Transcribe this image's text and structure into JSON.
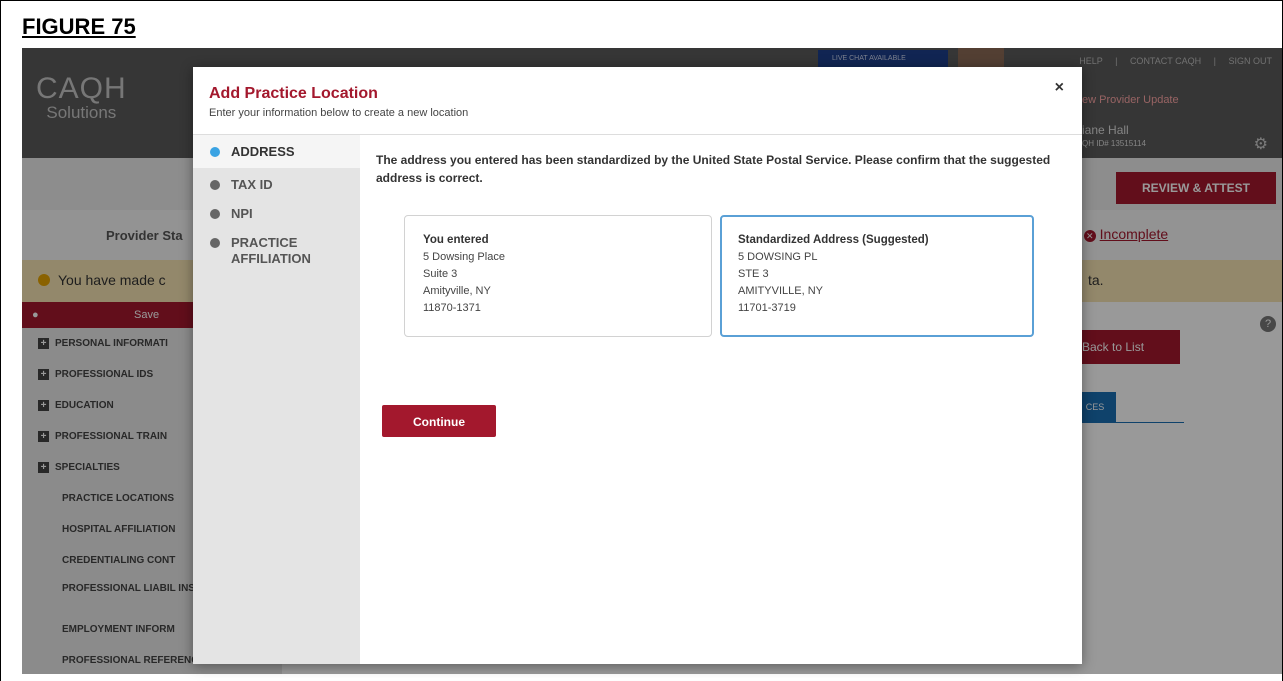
{
  "figure_label": "FIGURE 75",
  "app": {
    "logo_top": "CAQH",
    "logo_bottom": "Solutions",
    "live_chat": "LIVE CHAT AVAILABLE",
    "top_links": [
      "HELP",
      "|",
      "CONTACT CAQH",
      "|",
      "SIGN OUT"
    ],
    "update_link": "ew Provider Update",
    "user_name": "iane Hall",
    "user_id": "QH ID# 13515114",
    "review_button": "REVIEW & ATTEST",
    "status_left": "Provider Sta",
    "status_right_prefix": ":",
    "status_right_value": "Incomplete",
    "warning_left": "You have made c",
    "warning_right": "ta.",
    "save_label": "Save",
    "back_button": "Back to List",
    "tab_label": "CES",
    "sidebar": [
      {
        "label": "PERSONAL INFORMATI",
        "expandable": true
      },
      {
        "label": "PROFESSIONAL IDS",
        "expandable": true
      },
      {
        "label": "EDUCATION",
        "expandable": true
      },
      {
        "label": "PROFESSIONAL TRAIN",
        "expandable": true
      },
      {
        "label": "SPECIALTIES",
        "expandable": true
      },
      {
        "label": "PRACTICE LOCATIONS",
        "expandable": false
      },
      {
        "label": "HOSPITAL AFFILIATION",
        "expandable": false
      },
      {
        "label": "CREDENTIALING CONT",
        "expandable": false
      },
      {
        "label": "PROFESSIONAL LIABIL INSURANCE",
        "expandable": false
      },
      {
        "label": "EMPLOYMENT INFORM",
        "expandable": false
      },
      {
        "label": "PROFESSIONAL REFERENCES",
        "expandable": false
      }
    ]
  },
  "modal": {
    "title": "Add Practice Location",
    "subtitle": "Enter your information below to create a new location",
    "close": "×",
    "steps": [
      {
        "label": "ADDRESS",
        "active": true
      },
      {
        "label": "TAX ID",
        "active": false
      },
      {
        "label": "NPI",
        "active": false
      },
      {
        "label": "PRACTICE AFFILIATION",
        "active": false
      }
    ],
    "message": "The address you entered has been standardized by the United State Postal Service. Please confirm that the suggested address is correct.",
    "entered": {
      "heading": "You entered",
      "line1": "5 Dowsing Place",
      "line2": "Suite 3",
      "line3": "Amityville, NY",
      "line4": "11870-1371"
    },
    "suggested": {
      "heading": "Standardized Address (Suggested)",
      "line1": "5 DOWSING PL",
      "line2": "STE 3",
      "line3": "AMITYVILLE, NY",
      "line4": "11701-3719"
    },
    "continue_button": "Continue"
  },
  "colors": {
    "brand_red": "#a3182d",
    "active_blue": "#3aa3e3",
    "selected_border": "#5aa0d6"
  }
}
